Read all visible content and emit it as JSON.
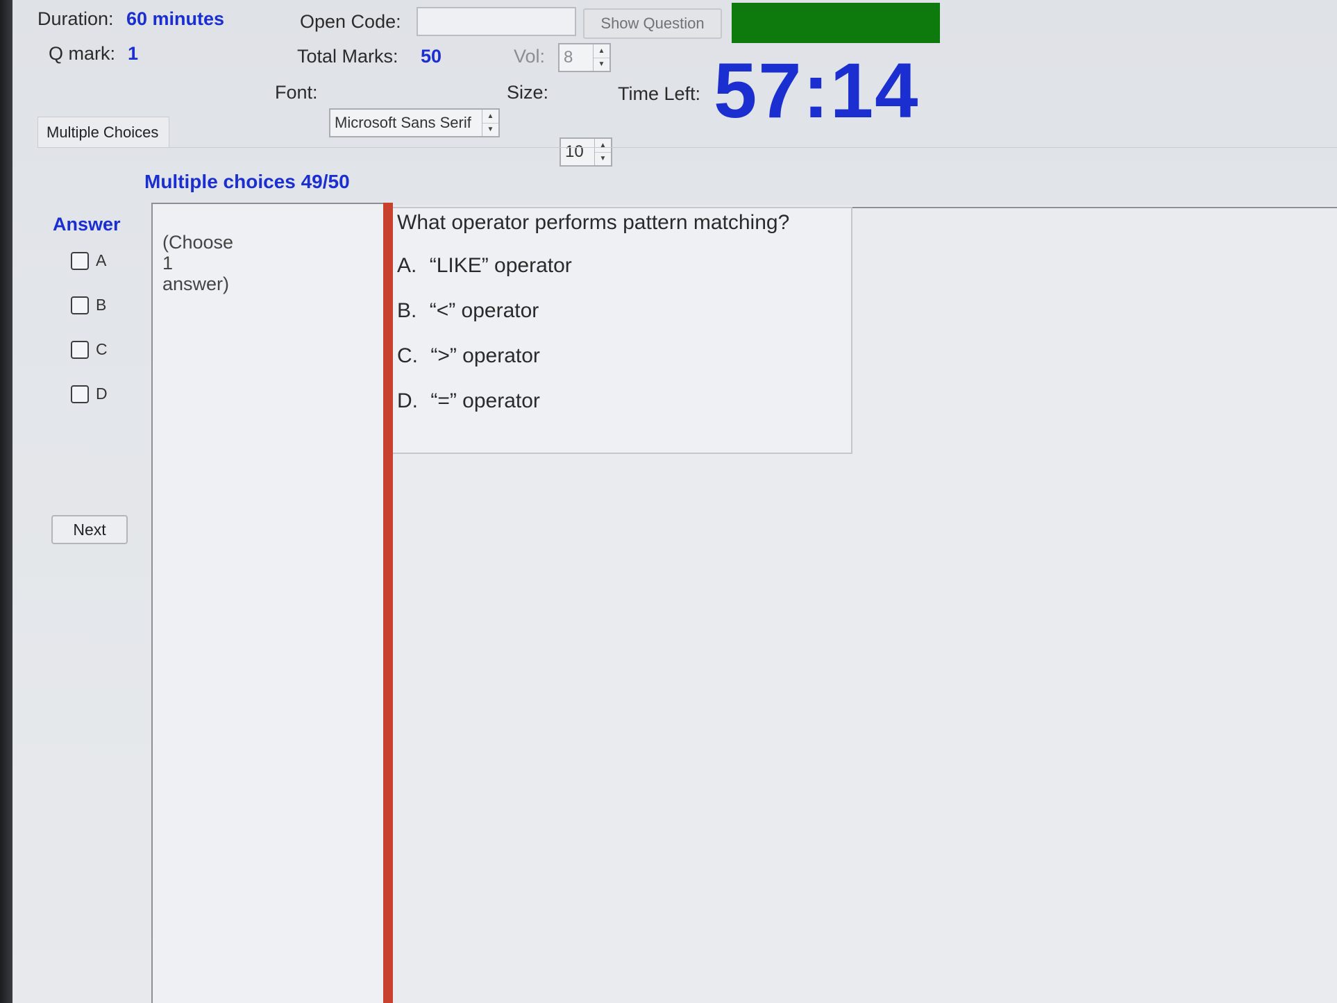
{
  "header": {
    "duration_label": "Duration:",
    "duration_value": "60 minutes",
    "qmark_label": "Q mark:",
    "qmark_value": "1",
    "open_code_label": "Open Code:",
    "open_code_value": "",
    "show_question_label": "Show Question",
    "total_marks_label": "Total Marks:",
    "total_marks_value": "50",
    "vol_label": "Vol:",
    "vol_value": "8",
    "font_label": "Font:",
    "font_value": "Microsoft Sans Serif",
    "size_label": "Size:",
    "size_value": "10",
    "time_left_label": "Time Left:",
    "time_left_value": "57:14",
    "status_color": "#0e7a0e",
    "accent_color": "#1b2fd0"
  },
  "tabs": [
    {
      "label": "Multiple Choices",
      "active": true
    }
  ],
  "question": {
    "section_title": "Multiple choices 49/50",
    "instruction": "(Choose\n1\nanswer)",
    "text": "What operator performs pattern matching?",
    "options": [
      {
        "key": "A.",
        "text": "“LIKE” operator"
      },
      {
        "key": "B.",
        "text": "“<” operator"
      },
      {
        "key": "C.",
        "text": "“>” operator"
      },
      {
        "key": "D.",
        "text": "“=” operator"
      }
    ]
  },
  "answer": {
    "title": "Answer",
    "choices": [
      {
        "label": "A",
        "checked": false
      },
      {
        "label": "B",
        "checked": false
      },
      {
        "label": "C",
        "checked": false
      },
      {
        "label": "D",
        "checked": false
      }
    ],
    "next_label": "Next"
  }
}
